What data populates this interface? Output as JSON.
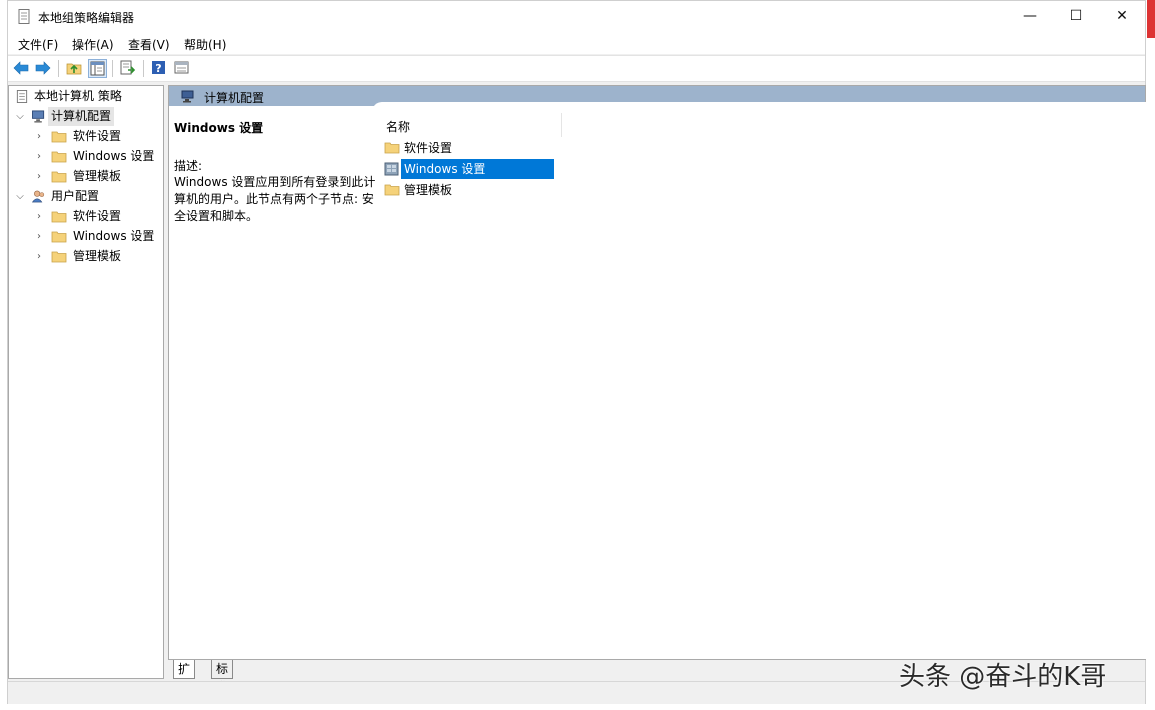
{
  "window": {
    "title": "本地组策略编辑器",
    "controls": {
      "minimize": "—",
      "maximize": "☐",
      "close": "✕"
    }
  },
  "menu": [
    "文件(F)",
    "操作(A)",
    "查看(V)",
    "帮助(H)"
  ],
  "toolbar": {
    "buttons": [
      "back-arrow-icon",
      "forward-arrow-icon",
      "up-folder-icon",
      "show-hide-tree-icon",
      "export-list-icon",
      "help-icon",
      "properties-view-icon"
    ]
  },
  "tree": {
    "root": "本地计算机 策略",
    "computer_config": "计算机配置",
    "user_config": "用户配置",
    "computer_children": [
      "软件设置",
      "Windows 设置",
      "管理模板"
    ],
    "user_children": [
      "软件设置",
      "Windows 设置",
      "管理模板"
    ]
  },
  "pane": {
    "header_title": "计算机配置",
    "desc_title": "Windows 设置",
    "desc_label": "描述:",
    "desc_text": "Windows 设置应用到所有登录到此计算机的用户。此节点有两个子节点: 安全设置和脚本。",
    "column_name": "名称",
    "items": [
      {
        "label": "软件设置",
        "icon": "folder-icon",
        "selected": false
      },
      {
        "label": "Windows 设置",
        "icon": "settings-icon",
        "selected": true
      },
      {
        "label": "管理模板",
        "icon": "folder-icon",
        "selected": false
      }
    ]
  },
  "tabs": [
    "扩展",
    "标准"
  ],
  "watermark": "头条 @奋斗的K哥",
  "colors": {
    "header_bar": "#9db3cc",
    "selection": "#0078d7",
    "folder": "#f5d27a"
  }
}
